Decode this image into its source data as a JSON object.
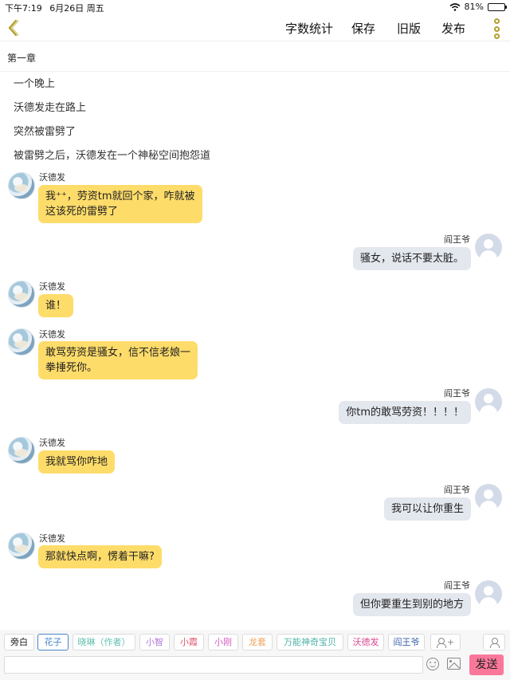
{
  "status_bar": {
    "time": "下午7:19",
    "date": "6月26日 周五",
    "battery": "81%",
    "battery_level": 0.81
  },
  "toolbar": {
    "word_count": "字数统计",
    "save": "保存",
    "old_version": "旧版",
    "publish": "发布",
    "accent_color": "#b3a02a"
  },
  "chapter": {
    "title": "第一章"
  },
  "narration": [
    "一个晚上",
    "沃德发走在路上",
    "突然被雷劈了",
    "被雷劈之后，沃德发在一个神秘空间抱怨道"
  ],
  "messages": [
    {
      "side": "left",
      "name": "沃德发",
      "lines": [
        "我⁺⁺，劳资tm就回个家，咋就被",
        "这该死的雷劈了"
      ]
    },
    {
      "side": "right",
      "name": "阎王爷",
      "lines": [
        "骚女，说话不要太脏。"
      ]
    },
    {
      "side": "left",
      "name": "沃德发",
      "lines": [
        "谁！"
      ]
    },
    {
      "side": "left",
      "name": "沃德发",
      "lines": [
        "敢骂劳资是骚女，信不信老娘一",
        "拳捶死你。"
      ]
    },
    {
      "side": "right",
      "name": "阎王爷",
      "lines": [
        "你tm的敢骂劳资！！！！"
      ]
    },
    {
      "side": "left",
      "name": "沃德发",
      "lines": [
        "我就骂你咋地"
      ]
    },
    {
      "side": "right",
      "name": "阎王爷",
      "lines": [
        "我可以让你重生"
      ]
    },
    {
      "side": "left",
      "name": "沃德发",
      "lines": [
        "那就快点啊，愣着干嘛?"
      ]
    },
    {
      "side": "right",
      "name": "阎王爷",
      "lines": [
        "但你要重生到别的地方"
      ]
    }
  ],
  "bubble_colors": {
    "left": "#fedc6a",
    "right": "#e3e7ee"
  },
  "roles": [
    {
      "label": "旁白",
      "color": "#222222"
    },
    {
      "label": "花子",
      "color": "#4a86c8"
    },
    {
      "label": "晓琳（作者）",
      "color": "#5fbfb0"
    },
    {
      "label": "小智",
      "color": "#b27ad8"
    },
    {
      "label": "小霞",
      "color": "#e0566c"
    },
    {
      "label": "小刚",
      "color": "#d25fbf"
    },
    {
      "label": "龙套",
      "color": "#eea35a"
    },
    {
      "label": "万能神奇宝贝",
      "color": "#4fb2a8"
    },
    {
      "label": "沃德发",
      "color": "#d8478e"
    },
    {
      "label": "阎王爷",
      "color": "#3e62a8"
    }
  ],
  "input": {
    "placeholder": "",
    "send": "发送",
    "send_color": "#f9789a"
  }
}
